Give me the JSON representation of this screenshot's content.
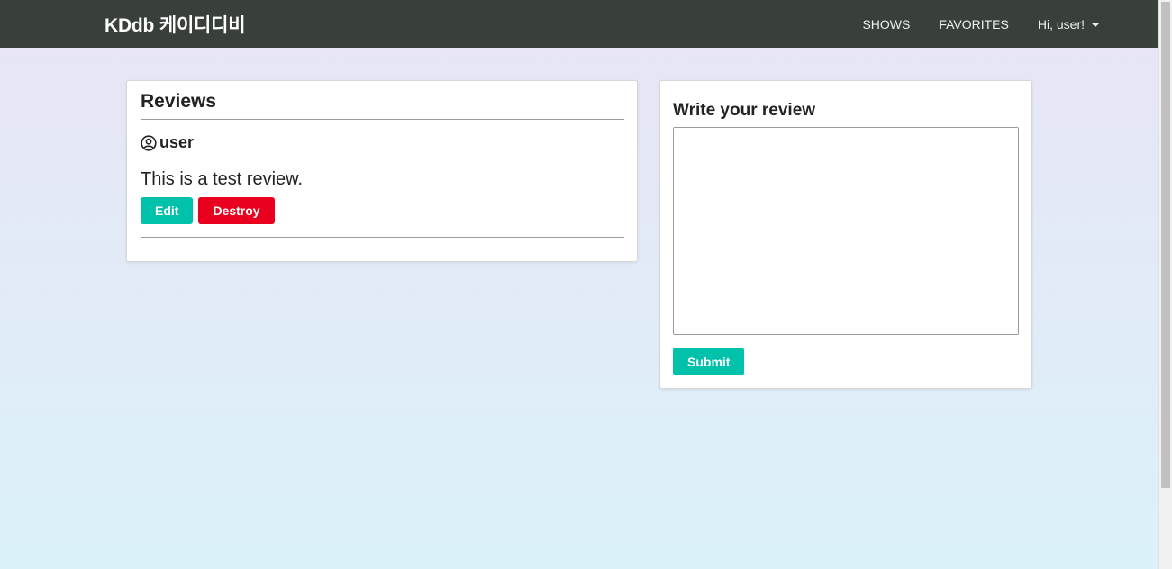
{
  "navbar": {
    "brand": "KDdb 케이디디비",
    "links": {
      "shows": "SHOWS",
      "favorites": "FAVORITES",
      "user_menu": "Hi, user!"
    }
  },
  "reviews": {
    "title": "Reviews",
    "items": [
      {
        "user": "user",
        "text": "This is a test review.",
        "edit_label": "Edit",
        "destroy_label": "Destroy"
      }
    ]
  },
  "write_review": {
    "title": "Write your review",
    "textarea_value": "",
    "textarea_placeholder": "",
    "submit_label": "Submit"
  },
  "colors": {
    "navbar_bg": "#384039",
    "primary_teal": "#00c1a9",
    "danger_red": "#e8001e"
  }
}
